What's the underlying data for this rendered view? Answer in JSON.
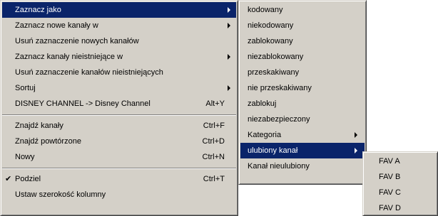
{
  "main_menu": {
    "items": [
      {
        "label": "Zaznacz jako",
        "submenu": true,
        "selected": true
      },
      {
        "label": "Zaznacz nowe kanały w",
        "submenu": true
      },
      {
        "label": "Usuń zaznaczenie nowych kanałów"
      },
      {
        "label": "Zaznacz kanały nieistniejące w",
        "submenu": true
      },
      {
        "label": "Usuń zaznaczenie kanałów nieistniejących"
      },
      {
        "label": "Sortuj",
        "submenu": true
      },
      {
        "label": "DISNEY CHANNEL -> Disney Channel",
        "shortcut": "Alt+Y"
      },
      {
        "label": "Znajdź kanały",
        "shortcut": "Ctrl+F"
      },
      {
        "label": "Znajdź powtórzone",
        "shortcut": "Ctrl+D"
      },
      {
        "label": "Nowy",
        "shortcut": "Ctrl+N"
      },
      {
        "label": "Podziel",
        "shortcut": "Ctrl+T",
        "checked": true,
        "check_glyph": "✔"
      },
      {
        "label": "Ustaw szerokość kolumny"
      }
    ]
  },
  "submenu_mark_as": {
    "items": [
      {
        "label": "kodowany"
      },
      {
        "label": "niekodowany"
      },
      {
        "label": "zablokowany"
      },
      {
        "label": "niezablokowany"
      },
      {
        "label": "przeskakiwany"
      },
      {
        "label": "nie przeskakiwany"
      },
      {
        "label": "zablokuj"
      },
      {
        "label": "niezabezpieczony"
      },
      {
        "label": "Kategoria",
        "submenu": true
      },
      {
        "label": "ulubiony kanał",
        "submenu": true,
        "selected": true
      },
      {
        "label": "Kanał nieulubiony"
      }
    ]
  },
  "submenu_favorite": {
    "items": [
      {
        "label": "FAV A"
      },
      {
        "label": "FAV B"
      },
      {
        "label": "FAV C"
      },
      {
        "label": "FAV D"
      }
    ]
  },
  "colors": {
    "menu_bg": "#d4d0c8",
    "highlight_bg": "#0a246a",
    "highlight_text": "#ffffff"
  }
}
